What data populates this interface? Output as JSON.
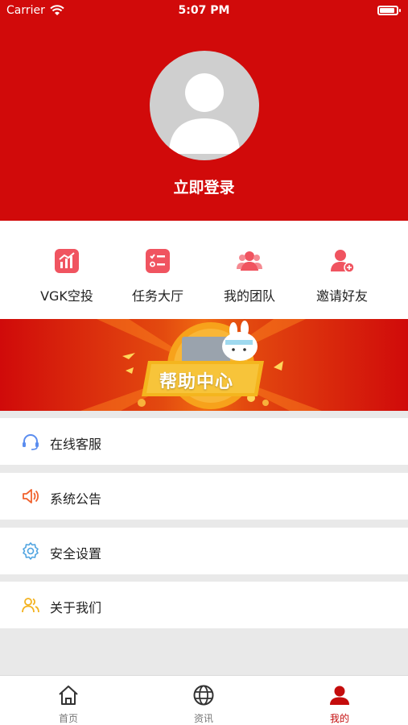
{
  "status_bar": {
    "carrier": "Carrier",
    "time": "5:07 PM"
  },
  "colors": {
    "primary_red": "#d10a0a",
    "tab_active": "#c40c0c",
    "background": "#e9e9e9"
  },
  "profile": {
    "login_label": "立即登录"
  },
  "actions": [
    {
      "label": "VGK空投",
      "icon": "bar-chart-icon"
    },
    {
      "label": "任务大厅",
      "icon": "task-list-icon"
    },
    {
      "label": "我的团队",
      "icon": "team-icon"
    },
    {
      "label": "邀请好友",
      "icon": "add-user-icon"
    }
  ],
  "banner": {
    "label": "帮助中心"
  },
  "menu": [
    {
      "label": "在线客服",
      "icon": "headset-icon"
    },
    {
      "label": "系统公告",
      "icon": "speaker-icon"
    },
    {
      "label": "安全设置",
      "icon": "gear-icon"
    },
    {
      "label": "关于我们",
      "icon": "users-icon"
    }
  ],
  "tabbar": {
    "tabs": [
      {
        "label": "首页",
        "icon": "home-icon"
      },
      {
        "label": "资讯",
        "icon": "globe-icon"
      },
      {
        "label": "我的",
        "icon": "profile-icon",
        "active": true
      }
    ]
  }
}
